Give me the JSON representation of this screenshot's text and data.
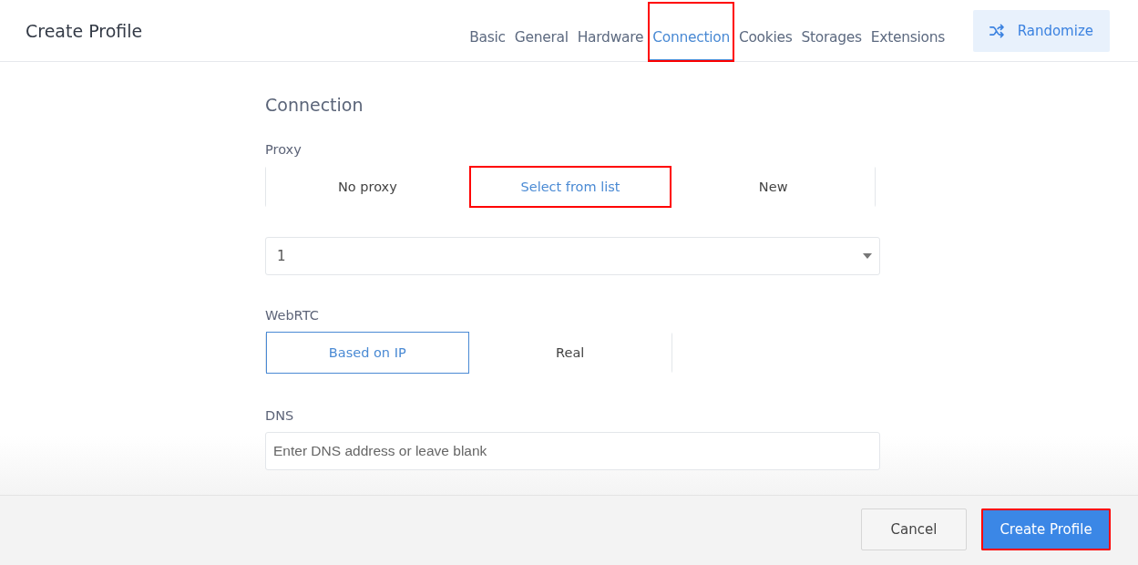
{
  "header": {
    "title": "Create Profile"
  },
  "tabs": [
    {
      "label": "Basic",
      "selected": false,
      "highlighted": false
    },
    {
      "label": "General",
      "selected": false,
      "highlighted": false
    },
    {
      "label": "Hardware",
      "selected": false,
      "highlighted": false
    },
    {
      "label": "Connection",
      "selected": true,
      "highlighted": true
    },
    {
      "label": "Cookies",
      "selected": false,
      "highlighted": false
    },
    {
      "label": "Storages",
      "selected": false,
      "highlighted": false
    },
    {
      "label": "Extensions",
      "selected": false,
      "highlighted": false
    }
  ],
  "randomize_button": {
    "label": "Randomize"
  },
  "section_title": "Connection",
  "proxy": {
    "label": "Proxy",
    "options": [
      {
        "label": "No proxy",
        "selected": false,
        "highlighted": false
      },
      {
        "label": "Select from list",
        "selected": true,
        "highlighted": true
      },
      {
        "label": "New",
        "selected": false,
        "highlighted": false
      }
    ],
    "dropdown": {
      "value": "1"
    }
  },
  "webrtc": {
    "label": "WebRTC",
    "options": [
      {
        "label": "Based on IP",
        "selected": true
      },
      {
        "label": "Real",
        "selected": false
      }
    ]
  },
  "dns": {
    "label": "DNS",
    "placeholder": "Enter DNS address or leave blank"
  },
  "footer": {
    "buttons": [
      {
        "label": "Cancel",
        "kind": "secondary",
        "highlighted": false
      },
      {
        "label": "Create Profile",
        "kind": "primary",
        "highlighted": true
      }
    ]
  }
}
